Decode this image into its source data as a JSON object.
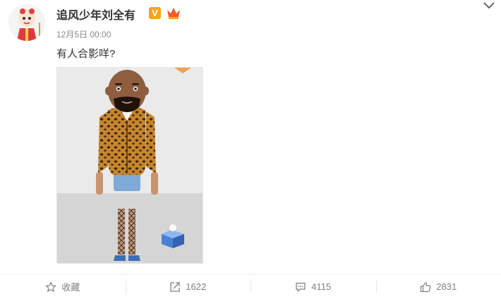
{
  "post": {
    "author": "追风少年刘全有",
    "vip_badge": "V",
    "timestamp": "12月5日 00:00",
    "text": "有人合影咩?"
  },
  "actions": {
    "favorite_label": "收藏",
    "repost_count": "1622",
    "comment_count": "4115",
    "like_count": "2831"
  },
  "icons": [
    "avatar",
    "vip-icon",
    "crown-icon",
    "chevron-down-icon",
    "star-icon",
    "share-icon",
    "comment-icon",
    "thumbs-up-icon"
  ],
  "colors": {
    "vip": "#f6a518",
    "crown": "#f35b2a",
    "muted": "#808080"
  }
}
